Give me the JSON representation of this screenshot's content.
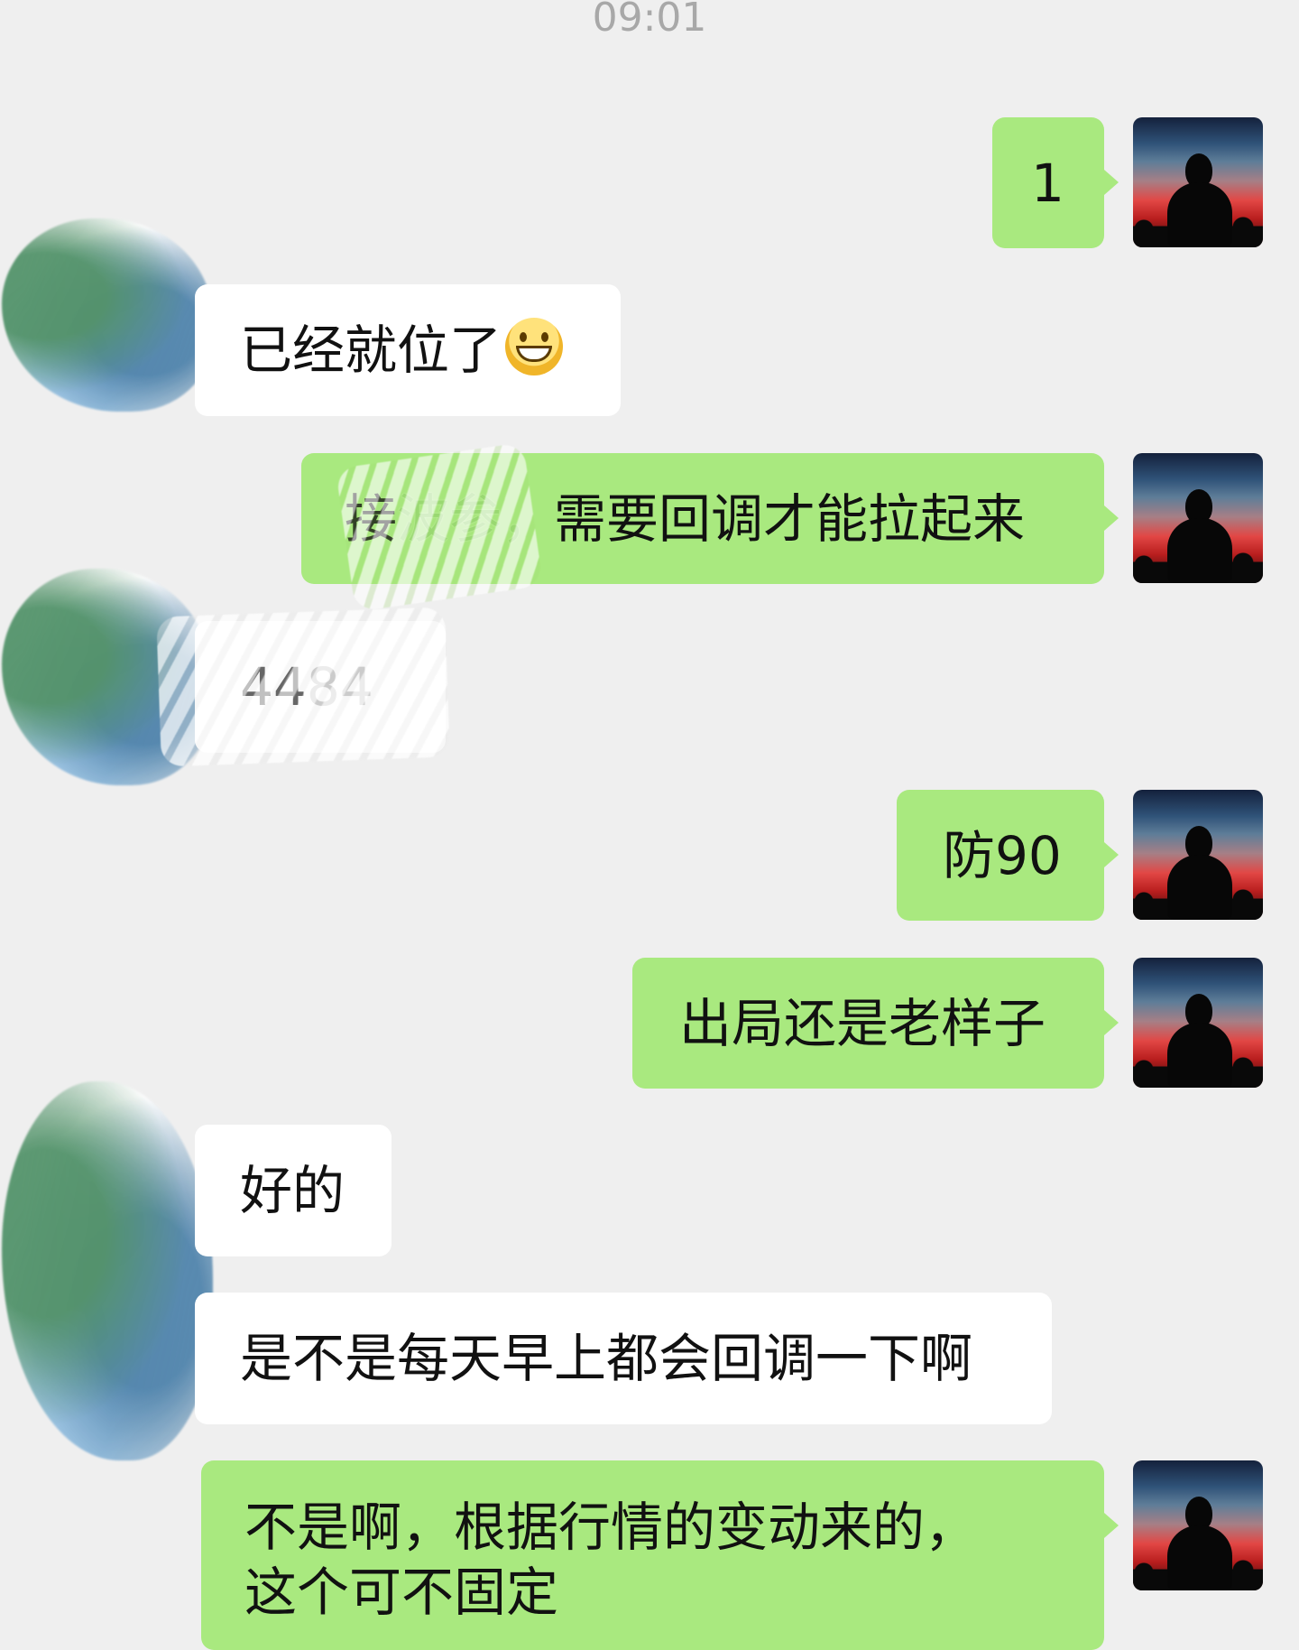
{
  "timestamp": "09:01",
  "messages": [
    {
      "text": "1"
    },
    {
      "text": "已经就位了",
      "emoji": "grinning-face-with-smiling-eyes"
    },
    {
      "text_a": "接",
      "text_b": "波",
      "text_c": "参，",
      "text_d": "需要回调才能拉起来"
    },
    {
      "text_a": "44",
      "text_b": "84"
    },
    {
      "text": "防90"
    },
    {
      "text": "出局还是老样子"
    },
    {
      "text": "好的"
    },
    {
      "text": "是不是每天早上都会回调一下啊"
    },
    {
      "line1": "不是啊，根据行情的变动来的，",
      "line2": "这个可不固定"
    }
  ]
}
